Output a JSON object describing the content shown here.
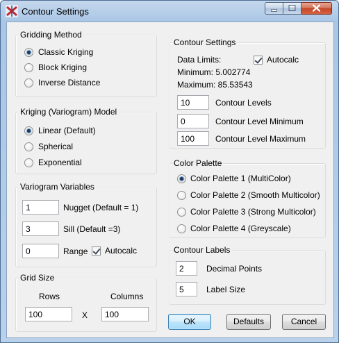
{
  "window": {
    "title": "Contour Settings",
    "controls": [
      "minimize-icon",
      "maximize-icon",
      "close-icon"
    ]
  },
  "gridding": {
    "label": "Gridding Method",
    "options": [
      "Classic Kriging",
      "Block Kriging",
      "Inverse Distance"
    ],
    "selected": "Classic Kriging"
  },
  "kriging": {
    "label": "Kriging (Variogram) Model",
    "options": [
      "Linear (Default)",
      "Spherical",
      "Exponential"
    ],
    "selected": "Linear (Default)"
  },
  "variogram": {
    "label": "Variogram Variables",
    "nugget_value": "1",
    "nugget_label": "Nugget (Default = 1)",
    "sill_value": "3",
    "sill_label": "Sill (Default =3)",
    "range_value": "0",
    "range_label": "Range",
    "autocalc_label": "Autocalc",
    "autocalc_checked": true
  },
  "grid_size": {
    "label": "Grid Size",
    "rows_label": "Rows",
    "columns_label": "Columns",
    "rows_value": "100",
    "columns_value": "100",
    "x_label": "X"
  },
  "contour": {
    "label": "Contour Settings",
    "data_limits_label": "Data Limits:",
    "minimum_text": "Minimum: 5.002774",
    "maximum_text": "Maximum: 85.53543",
    "autocalc_label": "Autocalc",
    "autocalc_checked": true,
    "levels_value": "10",
    "levels_label": "Contour Levels",
    "min_value": "0",
    "min_label": "Contour Level Minimum",
    "max_value": "100",
    "max_label": "Contour Level Maximum"
  },
  "palette": {
    "label": "Color Palette",
    "options": [
      "Color Palette 1 (MultiColor)",
      "Color Palette 2 (Smooth Multicolor)",
      "Color Palette 3 (Strong Multicolor)",
      "Color Palette 4 (Greyscale)"
    ],
    "selected": "Color Palette 1 (MultiColor)"
  },
  "labels": {
    "label": "Contour Labels",
    "decimal_value": "2",
    "decimal_label": "Decimal Points",
    "size_value": "5",
    "size_label": "Label Size"
  },
  "buttons": {
    "ok": "OK",
    "defaults": "Defaults",
    "cancel": "Cancel"
  }
}
